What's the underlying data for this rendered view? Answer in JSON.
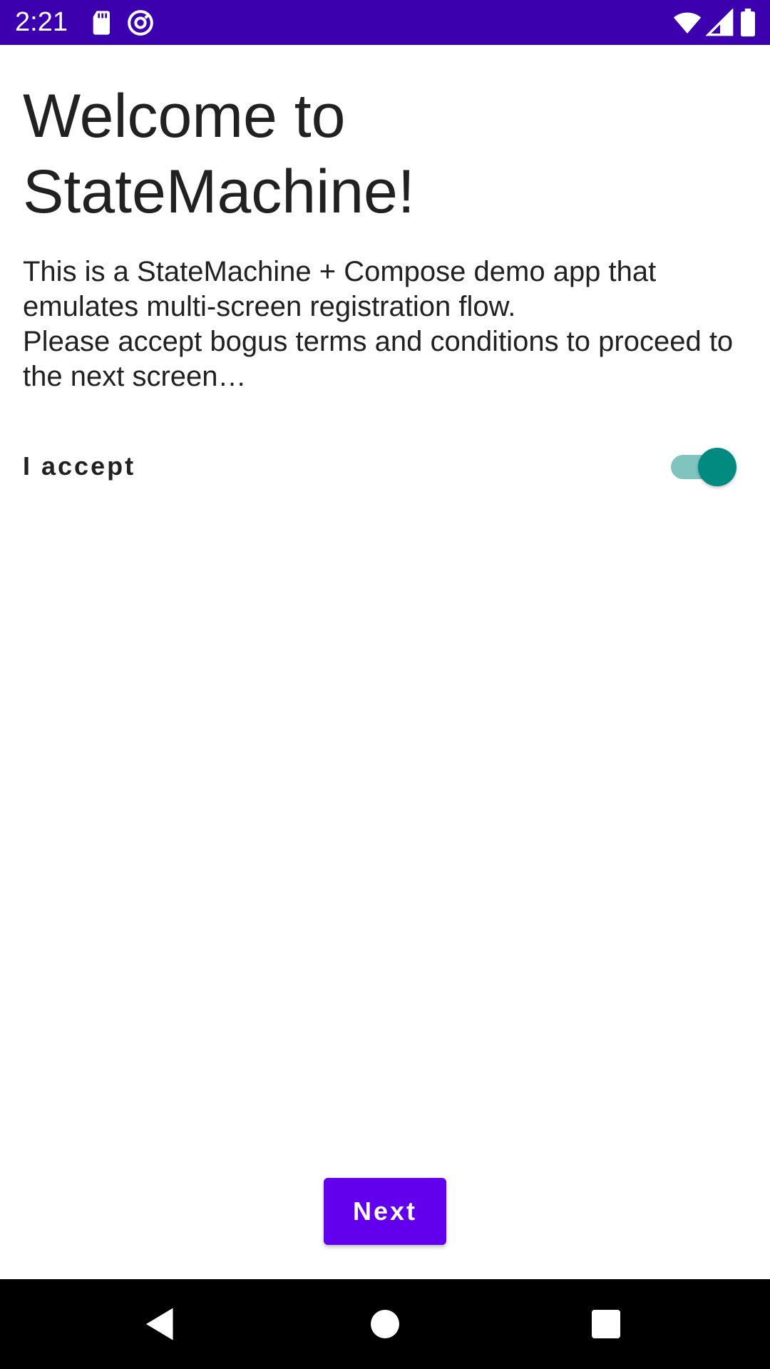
{
  "status_bar": {
    "time": "2:21",
    "left_icons": [
      "sd-card-icon",
      "at-sign-icon"
    ],
    "right_icons": [
      "wifi-icon",
      "cellular-signal-icon",
      "battery-icon"
    ],
    "background": "#3c00ae"
  },
  "welcome": {
    "title": "Welcome to StateMachine!",
    "description": "This is a StateMachine + Compose demo app that emulates multi-screen registration flow.\nPlease accept bogus terms and conditions to proceed to the next screen…"
  },
  "terms": {
    "label": "I accept",
    "accepted": true,
    "accent_color": "#008a80"
  },
  "actions": {
    "next_label": "Next",
    "button_color": "#6200ee"
  },
  "nav_bar": {
    "buttons": [
      "back-icon",
      "home-icon",
      "recents-icon"
    ]
  }
}
